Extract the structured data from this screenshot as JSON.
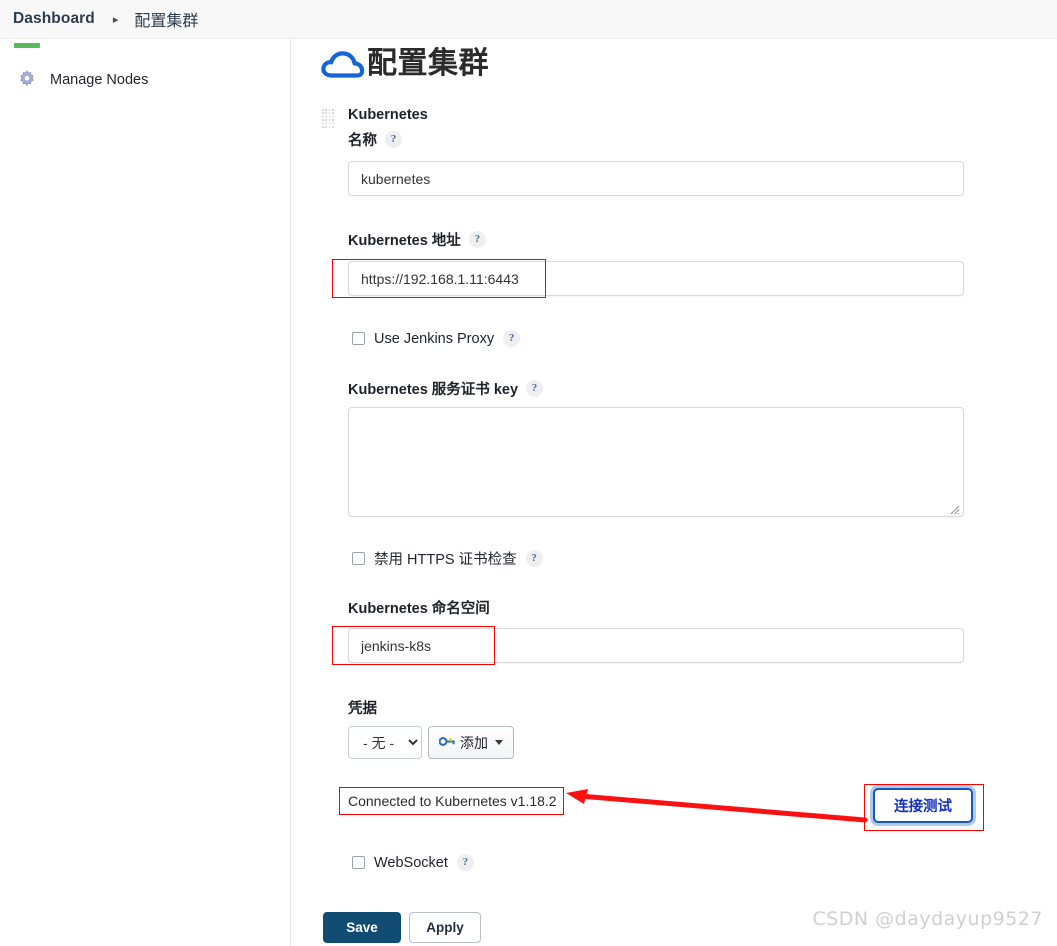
{
  "breadcrumb": {
    "root": "Dashboard",
    "separator": "▸",
    "current": "配置集群"
  },
  "sidebar": {
    "items": [
      {
        "label": "Manage Nodes",
        "icon": "gear-icon"
      }
    ]
  },
  "page": {
    "title": "配置集群",
    "icon": "cloud-icon"
  },
  "form": {
    "section_label": "Kubernetes",
    "help_glyph": "?",
    "fields": {
      "name": {
        "label": "名称",
        "value": "kubernetes"
      },
      "url": {
        "label": "Kubernetes 地址",
        "value": "https://192.168.1.11:6443"
      },
      "proxy": {
        "label": "Use Jenkins Proxy",
        "checked": false
      },
      "cert_key": {
        "label": "Kubernetes 服务证书 key",
        "value": ""
      },
      "disable_https_check": {
        "label": "禁用 HTTPS 证书检查",
        "checked": false
      },
      "namespace": {
        "label": "Kubernetes 命名空间",
        "value": "jenkins-k8s"
      },
      "credentials": {
        "label": "凭据",
        "selected": "- 无 -",
        "options": [
          "- 无 -"
        ],
        "add_button": "添加",
        "add_icon": "key-icon"
      },
      "websocket": {
        "label": "WebSocket",
        "checked": false
      }
    },
    "connection": {
      "status": "Connected to Kubernetes v1.18.2",
      "test_button": "连接测试"
    },
    "actions": {
      "save": "Save",
      "apply": "Apply"
    }
  },
  "watermark": "CSDN @daydayup9527",
  "colors": {
    "accent_blue": "#1657c8",
    "save_navy": "#114c72",
    "annotation_red": "#ff0000",
    "header_bg": "#f8f8f8",
    "nav_green": "#5cb85c"
  }
}
